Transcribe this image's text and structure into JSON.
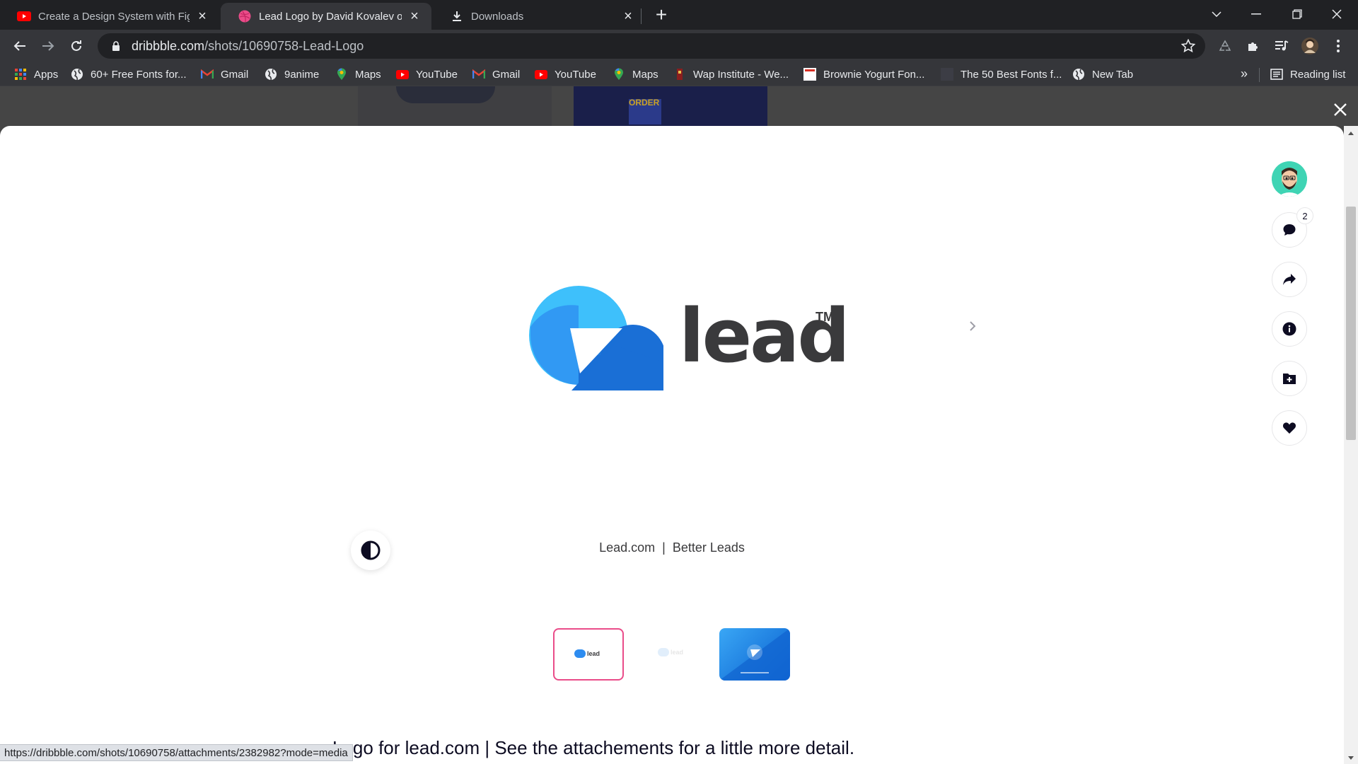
{
  "browser": {
    "tabs": [
      {
        "title": "Create a Design System with Figma",
        "favicon": "youtube-icon",
        "active": false
      },
      {
        "title": "Lead Logo by David Kovalev on Dribbble",
        "favicon": "dribbble-icon",
        "active": true
      },
      {
        "title": "Downloads",
        "favicon": "download-icon",
        "active": false
      }
    ],
    "address": {
      "host": "dribbble.com",
      "path": "/shots/10690758-Lead-Logo"
    },
    "bookmarks": [
      {
        "label": "Apps",
        "icon": "apps-grid-icon"
      },
      {
        "label": "60+ Free Fonts for...",
        "icon": "globe-icon"
      },
      {
        "label": "Gmail",
        "icon": "gmail-icon"
      },
      {
        "label": "9anime",
        "icon": "globe-icon"
      },
      {
        "label": "Maps",
        "icon": "maps-icon"
      },
      {
        "label": "YouTube",
        "icon": "youtube-icon"
      },
      {
        "label": "Gmail",
        "icon": "gmail-icon"
      },
      {
        "label": "YouTube",
        "icon": "youtube-icon"
      },
      {
        "label": "Maps",
        "icon": "maps-icon"
      },
      {
        "label": "Wap Institute - We...",
        "icon": "wap-icon"
      },
      {
        "label": "Brownie Yogurt Fon...",
        "icon": "page-icon"
      },
      {
        "label": "The 50 Best Fonts f...",
        "icon": "blank-icon"
      },
      {
        "label": "New Tab",
        "icon": "globe-icon"
      }
    ],
    "bookmarks_more": "»",
    "reading_list": "Reading list",
    "status_url": "https://dribbble.com/shots/10690758/attachments/2382982?mode=media"
  },
  "shot": {
    "logo_word": "lead",
    "logo_tm": "TM",
    "tagline": "Lead.com  |  Better Leads",
    "comment_count": "2",
    "description": "Logo for lead.com | See the attachements for a little more detail.",
    "thumbnails": [
      {
        "name": "attachment-1",
        "selected": true
      },
      {
        "name": "attachment-2",
        "selected": false
      },
      {
        "name": "attachment-3",
        "selected": false
      }
    ],
    "bg_thumb_text": "ORDER"
  },
  "colors": {
    "brand_pink": "#ea4c89",
    "logo_blue_light": "#3ec0fb",
    "logo_blue": "#2d8cf0",
    "logo_blue_dark": "#1a6fd6",
    "chrome_dark": "#202124",
    "chrome_toolbar": "#35363a"
  }
}
